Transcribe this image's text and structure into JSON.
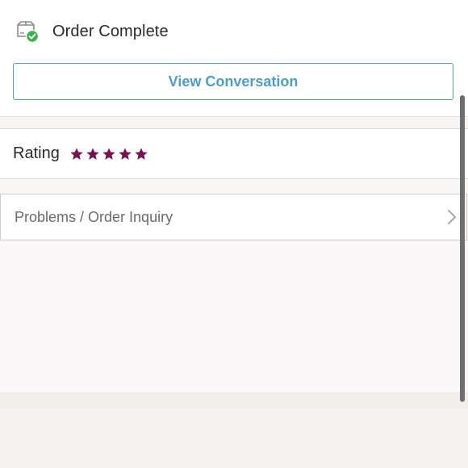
{
  "order_status": {
    "title": "Order Complete",
    "icon": "package-check-icon",
    "check_color": "#35b24a"
  },
  "actions": {
    "view_conversation_label": "View Conversation",
    "accent_color": "#4a9fce"
  },
  "rating": {
    "label": "Rating",
    "stars_filled": 5,
    "stars_total": 5,
    "star_color": "#7a0f52"
  },
  "problems": {
    "label": "Problems / Order Inquiry",
    "icon": "chevron-right-icon"
  }
}
